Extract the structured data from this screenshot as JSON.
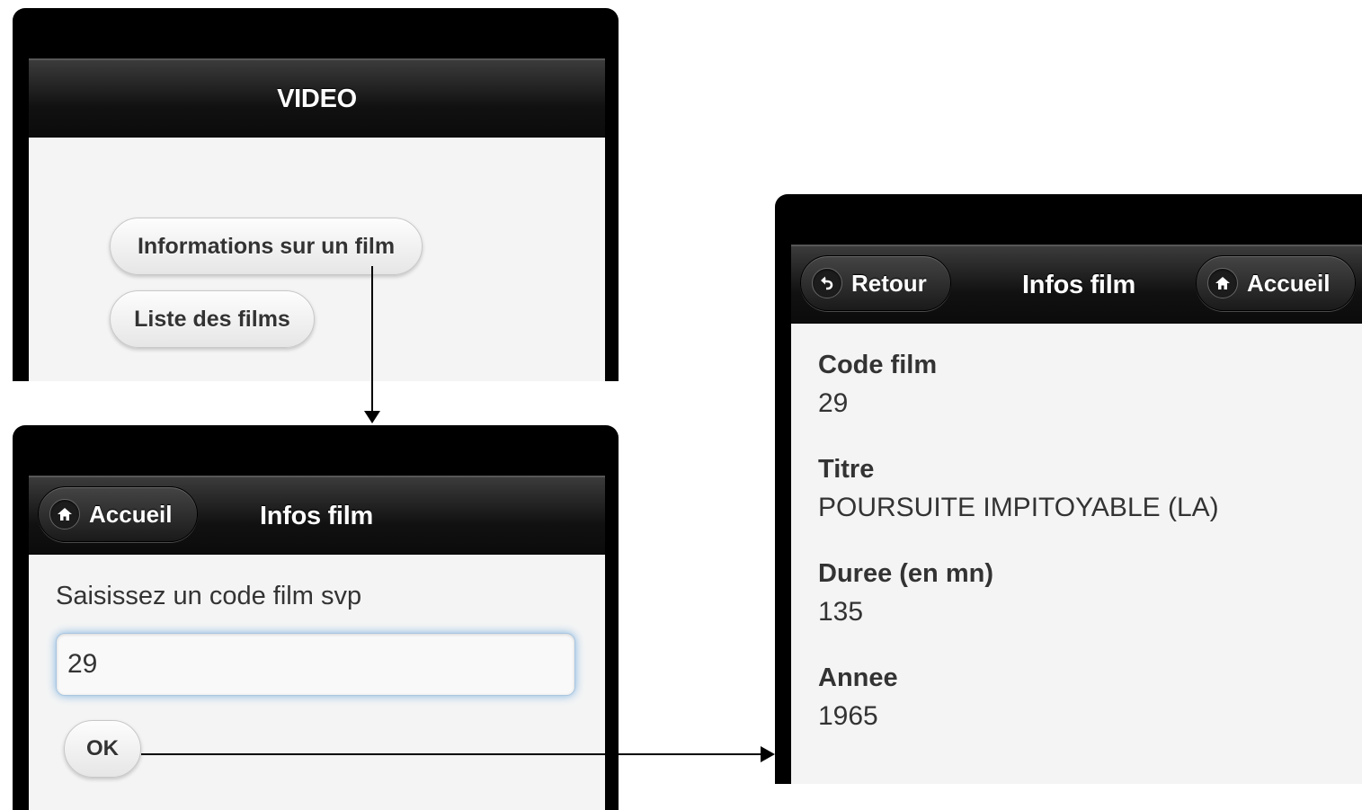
{
  "screen_home": {
    "title": "VIDEO",
    "buttons": [
      "Informations sur un film",
      "Liste des films"
    ]
  },
  "screen_input": {
    "header_button": "Accueil",
    "title": "Infos film",
    "prompt": "Saisissez un code film svp",
    "input_value": "29",
    "ok_label": "OK"
  },
  "screen_result": {
    "back_button": "Retour",
    "title": "Infos film",
    "home_button": "Accueil",
    "fields": [
      {
        "label": "Code film",
        "value": "29"
      },
      {
        "label": "Titre",
        "value": "POURSUITE IMPITOYABLE (LA)"
      },
      {
        "label": "Duree (en mn)",
        "value": "135"
      },
      {
        "label": "Annee",
        "value": "1965"
      }
    ]
  },
  "icons": {
    "home": "home-icon",
    "back": "back-arrow-icon"
  }
}
